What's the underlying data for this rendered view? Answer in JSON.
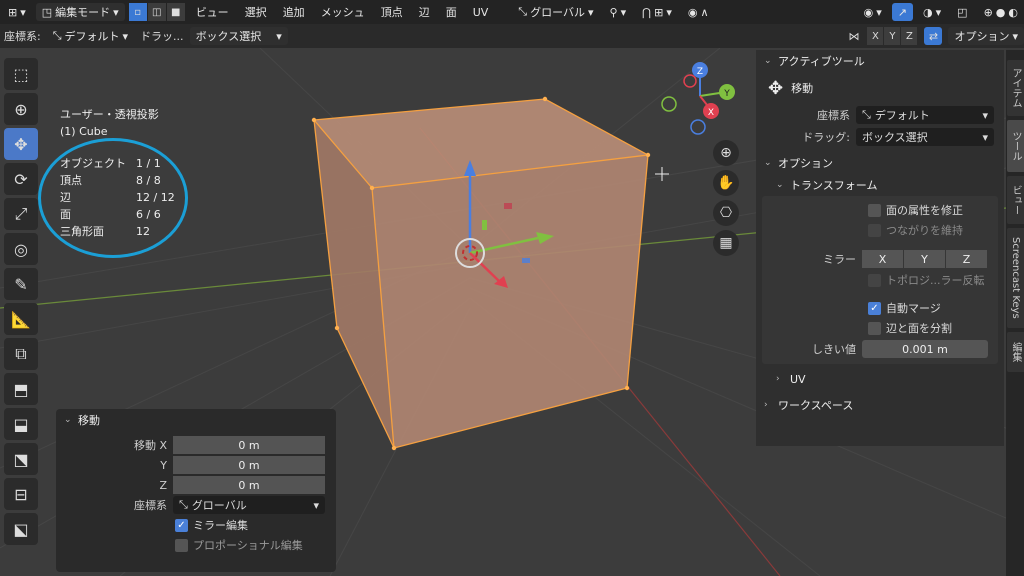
{
  "header": {
    "mode": "編集モード",
    "menus": [
      "ビュー",
      "選択",
      "追加",
      "メッシュ",
      "頂点",
      "辺",
      "面",
      "UV"
    ],
    "orientation": "グローバル"
  },
  "toolsettings": {
    "coord_label": "座標系:",
    "coord_value": "デフォルト",
    "drag_label": "ドラッ...",
    "drag_value": "ボックス選択",
    "axes": [
      "X",
      "Y",
      "Z"
    ],
    "options": "オプション"
  },
  "overlay": {
    "view_name": "ユーザー・透視投影",
    "object_name": "(1) Cube",
    "stats": [
      {
        "label": "オブジェクト",
        "value": "1 / 1"
      },
      {
        "label": "頂点",
        "value": "8 / 8"
      },
      {
        "label": "辺",
        "value": "12 / 12"
      },
      {
        "label": "面",
        "value": "6 / 6"
      },
      {
        "label": "三角形面",
        "value": "12"
      }
    ]
  },
  "gizmo": {
    "z": "Z",
    "y": "Y",
    "x": "X"
  },
  "panel": {
    "active_tool_header": "アクティブツール",
    "tool_name": "移動",
    "coord_label": "座標系",
    "coord_value": "デフォルト",
    "drag_label": "ドラッグ:",
    "drag_value": "ボックス選択",
    "options_header": "オプション",
    "transform_header": "トランスフォーム",
    "cb_face_attr": "面の属性を修正",
    "cb_keep_connected": "つながりを維持",
    "mirror_label": "ミラー",
    "mirror_axes": [
      "X",
      "Y",
      "Z"
    ],
    "cb_topology_mirror": "トポロジ...ラー反転",
    "cb_auto_merge": "自動マージ",
    "cb_split_edges": "辺と面を分割",
    "threshold_label": "しきい値",
    "threshold_value": "0.001 m",
    "uv_header": "UV",
    "workspace_header": "ワークスペース"
  },
  "vtabs": [
    "アイテム",
    "ツール",
    "ビュー",
    "Screencast Keys",
    "編集"
  ],
  "operator": {
    "title": "移動",
    "move_x_label": "移動 X",
    "move_x": "0 m",
    "y_label": "Y",
    "y": "0 m",
    "z_label": "Z",
    "z": "0 m",
    "coord_label": "座標系",
    "coord_value": "グローバル",
    "cb_mirror_edit": "ミラー編集",
    "cb_proportional": "プロポーショナル編集"
  },
  "colors": {
    "accent": "#4b79c8",
    "cube_face": "#b08672",
    "cube_edge": "#f5a040",
    "highlight_circle": "#1b9fd6",
    "axis_x": "#e04050",
    "axis_y": "#80c040",
    "axis_z": "#4a7fe0"
  }
}
